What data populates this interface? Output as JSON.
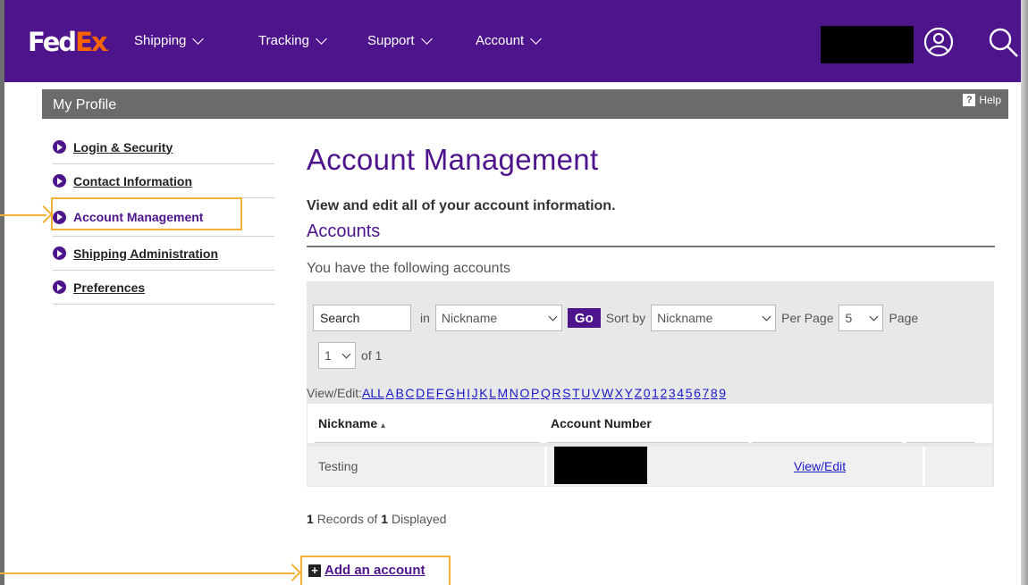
{
  "logo": {
    "fed": "Fed",
    "ex": "Ex",
    "dot": "."
  },
  "nav": {
    "items": [
      {
        "label": "Shipping"
      },
      {
        "label": "Tracking"
      },
      {
        "label": "Support"
      },
      {
        "label": "Account"
      }
    ],
    "icons": {
      "user": "user-circle-icon",
      "search": "search-icon"
    }
  },
  "profile_bar": {
    "title": "My Profile",
    "help_label": "Help",
    "help_icon": "?"
  },
  "sidebar": {
    "items": [
      {
        "label": "Login & Security"
      },
      {
        "label": "Contact Information"
      },
      {
        "label": "Account Management"
      },
      {
        "label": "Shipping Administration"
      },
      {
        "label": "Preferences"
      }
    ],
    "active_index": 2
  },
  "main": {
    "title": "Account Management",
    "subtitle": "View and edit all of your account information.",
    "section_title": "Accounts",
    "intro": "You have the following accounts"
  },
  "controls": {
    "search_value": "Search",
    "in_label": "in",
    "search_field_select": "Nickname",
    "go_label": "Go",
    "sort_label": "Sort by",
    "sort_select": "Nickname",
    "per_page_label": "Per Page",
    "per_page_select": "5",
    "page_label": "Page",
    "page_select": "1",
    "of_label": "of 1"
  },
  "alpha_filter": {
    "label": "View/Edit:",
    "letters": [
      "ALL",
      "A",
      "B",
      "C",
      "D",
      "E",
      "F",
      "G",
      "H",
      "I",
      "J",
      "K",
      "L",
      "M",
      "N",
      "O",
      "P",
      "Q",
      "R",
      "S",
      "T",
      "U",
      "V",
      "W",
      "X",
      "Y",
      "Z",
      "0",
      "1",
      "2",
      "3",
      "4",
      "5",
      "6",
      "7",
      "8",
      "9"
    ]
  },
  "table": {
    "headers": {
      "nickname": "Nickname",
      "sort_marker": "▴",
      "account_number": "Account Number"
    },
    "rows": [
      {
        "nickname": "Testing",
        "action": "View/Edit"
      }
    ]
  },
  "records": {
    "shown": "1",
    "middle": "Records of",
    "total": "1",
    "suffix": "Displayed"
  },
  "add_account": {
    "label": "Add an account",
    "icon": "+"
  },
  "colors": {
    "brand_purple": "#4d148c",
    "brand_orange": "#ff6200",
    "highlight": "#f2b134",
    "link": "#1a1acc"
  }
}
